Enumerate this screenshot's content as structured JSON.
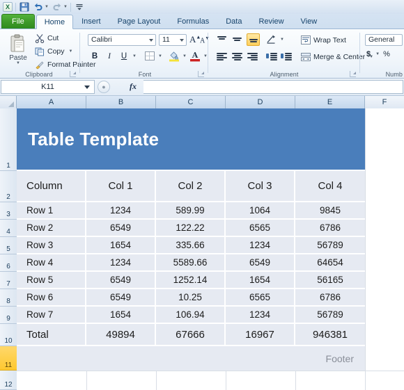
{
  "quick_access": {
    "app_logo": "excel-logo",
    "buttons": [
      {
        "name": "save-button",
        "icon": "save-icon"
      },
      {
        "name": "undo-button",
        "icon": "undo-icon"
      },
      {
        "name": "redo-button",
        "icon": "redo-icon"
      },
      {
        "name": "customize-qat-button",
        "icon": "customize-icon"
      }
    ]
  },
  "tabs": [
    {
      "label": "File",
      "active": false,
      "file": true
    },
    {
      "label": "Home",
      "active": true,
      "file": false
    },
    {
      "label": "Insert",
      "active": false,
      "file": false
    },
    {
      "label": "Page Layout",
      "active": false,
      "file": false
    },
    {
      "label": "Formulas",
      "active": false,
      "file": false
    },
    {
      "label": "Data",
      "active": false,
      "file": false
    },
    {
      "label": "Review",
      "active": false,
      "file": false
    },
    {
      "label": "View",
      "active": false,
      "file": false
    }
  ],
  "ribbon": {
    "clipboard": {
      "group_label": "Clipboard",
      "paste_label": "Paste",
      "cut_label": "Cut",
      "copy_label": "Copy",
      "format_painter_label": "Format Painter"
    },
    "font": {
      "group_label": "Font",
      "font_name": "Calibri",
      "font_size": "11",
      "bold_label": "B",
      "italic_label": "I",
      "underline_label": "U",
      "grow_font_label": "A",
      "shrink_font_label": "A"
    },
    "alignment": {
      "group_label": "Alignment",
      "wrap_text_label": "Wrap Text",
      "merge_center_label": "Merge & Center"
    },
    "number": {
      "group_label": "Numb",
      "format_value": "General",
      "currency_label": "$",
      "percent_label": "%"
    }
  },
  "formula_bar": {
    "name_box_value": "K11",
    "fx_label": "fx",
    "formula_value": ""
  },
  "grid": {
    "columns": [
      "A",
      "B",
      "C",
      "D",
      "E",
      "F"
    ],
    "rows": [
      "1",
      "2",
      "3",
      "4",
      "5",
      "6",
      "7",
      "8",
      "9",
      "10",
      "11",
      "12"
    ],
    "selected_row": "11",
    "selected_columns": [
      "A",
      "B",
      "C",
      "D",
      "E"
    ]
  },
  "table": {
    "banner_title": "Table Template",
    "banner_color": "#4a7ebb",
    "cell_fill": "#e6eaf2",
    "headers": [
      "Column",
      "Col 1",
      "Col 2",
      "Col 3",
      "Col 4"
    ],
    "rows": [
      [
        "Row 1",
        "1234",
        "589.99",
        "1064",
        "9845"
      ],
      [
        "Row 2",
        "6549",
        "122.22",
        "6565",
        "6786"
      ],
      [
        "Row 3",
        "1654",
        "335.66",
        "1234",
        "56789"
      ],
      [
        "Row 4",
        "1234",
        "5589.66",
        "6549",
        "64654"
      ],
      [
        "Row 5",
        "6549",
        "1252.14",
        "1654",
        "56165"
      ],
      [
        "Row 6",
        "6549",
        "10.25",
        "6565",
        "6786"
      ],
      [
        "Row 7",
        "1654",
        "106.94",
        "1234",
        "56789"
      ]
    ],
    "total": [
      "Total",
      "49894",
      "67666",
      "16967",
      "946381"
    ],
    "footer": "Footer"
  }
}
